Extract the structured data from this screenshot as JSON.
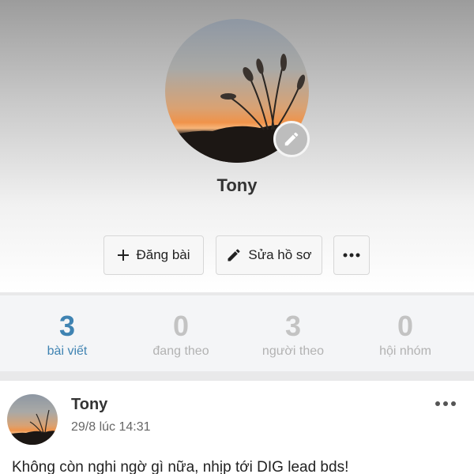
{
  "profile": {
    "name": "Tony"
  },
  "actions": {
    "post_label": "Đăng bài",
    "edit_label": "Sửa hồ sơ"
  },
  "stats": [
    {
      "value": "3",
      "label": "bài viết"
    },
    {
      "value": "0",
      "label": "đang theo"
    },
    {
      "value": "3",
      "label": "người theo"
    },
    {
      "value": "0",
      "label": "hội nhóm"
    }
  ],
  "post": {
    "author": "Tony",
    "time": "29/8 lúc 14:31",
    "text": "Không còn nghi ngờ gì nữa, nhịp tới DIG lead bds!"
  },
  "colors": {
    "accent": "#3f83b2",
    "muted": "#c3c3c3"
  },
  "icons": {
    "edit_badge": "pencil-icon",
    "post_button": "plus-icon",
    "edit_button": "pencil-icon",
    "more": "more-horizontal-icon"
  }
}
